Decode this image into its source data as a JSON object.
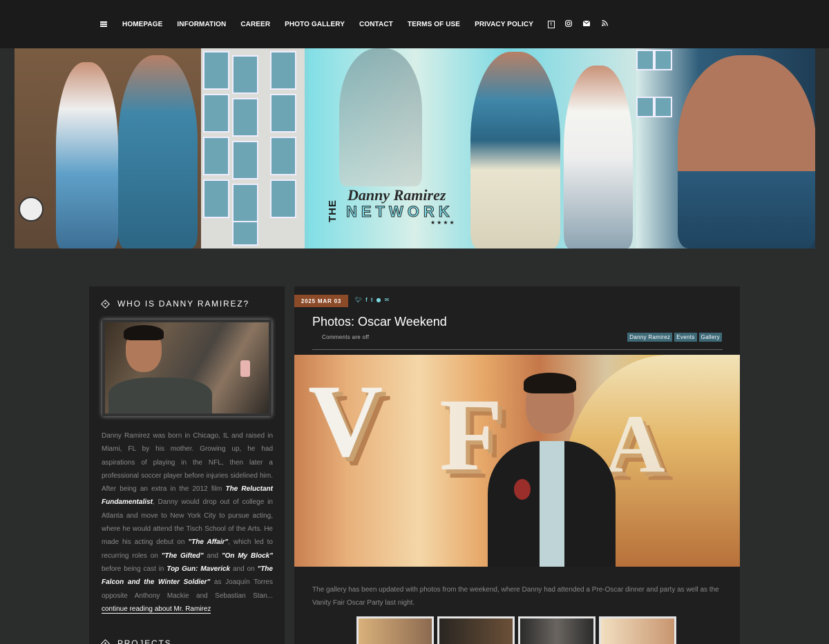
{
  "nav": {
    "items": [
      "HOMEPAGE",
      "INFORMATION",
      "CAREER",
      "PHOTO GALLERY",
      "CONTACT",
      "TERMS OF USE",
      "PRIVACY POLICY"
    ],
    "social_icons": [
      "tumblr-icon",
      "instagram-icon",
      "envelope-icon",
      "rss-icon"
    ]
  },
  "banner": {
    "logo_the": "THE",
    "logo_name": "Danny Ramirez",
    "logo_network": "NETWORK",
    "logo_stars": "★★★★"
  },
  "sidebar": {
    "title": "WHO IS DANNY RAMIREZ?",
    "bio": {
      "p1": "Danny Ramirez was born in Chicago, IL and raised in Miami, FL by his mother. Growing up, he had aspirations of playing in the NFL, then later a professional soccer player before injuries sidelined him. After being an extra in the 2012 film ",
      "film1": "The Reluctant Fundamentalist",
      "p2": ", Danny would drop out of college in Atlanta and move to New York City to pursue acting, where he would attend the Tisch School of the Arts. He made his acting debut on ",
      "show1": "\"The Affair\"",
      "p3": ", which led to recurring roles on ",
      "show2": "\"The Gifted\"",
      "p4": " and ",
      "show3": "\"On My Block\"",
      "p5": " before being cast in ",
      "film2": "Top Gun: Maverick",
      "p6": " and on ",
      "show4": "\"The Falcon and the Winter Soldier\"",
      "p7": " as Joaquín Torres opposite Anthony Mackie and Sebastian Stan...",
      "more": "continue reading about Mr. Ramirez"
    },
    "title2": "PROJECTS"
  },
  "post": {
    "date": "2025 MAR 03",
    "share_icons": [
      "twitter-icon",
      "facebook-icon",
      "tumblr-icon",
      "pinterest-icon",
      "envelope-icon"
    ],
    "title": "Photos: Oscar Weekend",
    "comments": "Comments are off",
    "tags": [
      "Danny Ramirez",
      "Events",
      "Gallery"
    ],
    "body": "The gallery has been updated with photos from the weekend, where Danny had attended a Pre-Oscar dinner and party as well as the Vanity Fair Oscar Party last night."
  },
  "colors": {
    "page_bg": "#2b2d2d",
    "nav_bg": "#1b1b1b",
    "panel_bg": "#1f1f1f",
    "date_badge": "#8b4a28",
    "accent": "#7bd9e3",
    "tag_bg": "#3e6a78"
  }
}
